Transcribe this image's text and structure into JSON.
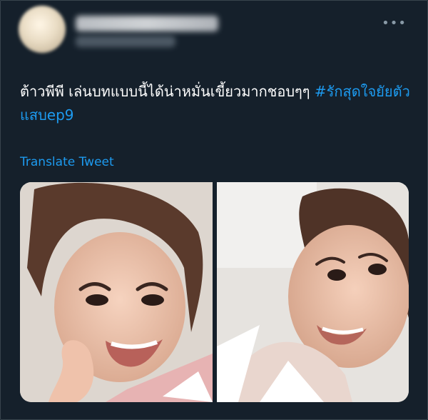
{
  "tweet": {
    "more_icon": "more-horizontal-icon",
    "text_main": "ต้าวพีพี เล่นบทแบบนี้ได้น่าหมั่นเขี้ยวมากชอบๆๆ ",
    "hashtag": "#รักสุดใจยัยตัวแสบep9",
    "translate_label": "Translate Tweet"
  },
  "colors": {
    "background": "#15202b",
    "link": "#1d9bf0",
    "secondary_text": "#8899a6"
  }
}
